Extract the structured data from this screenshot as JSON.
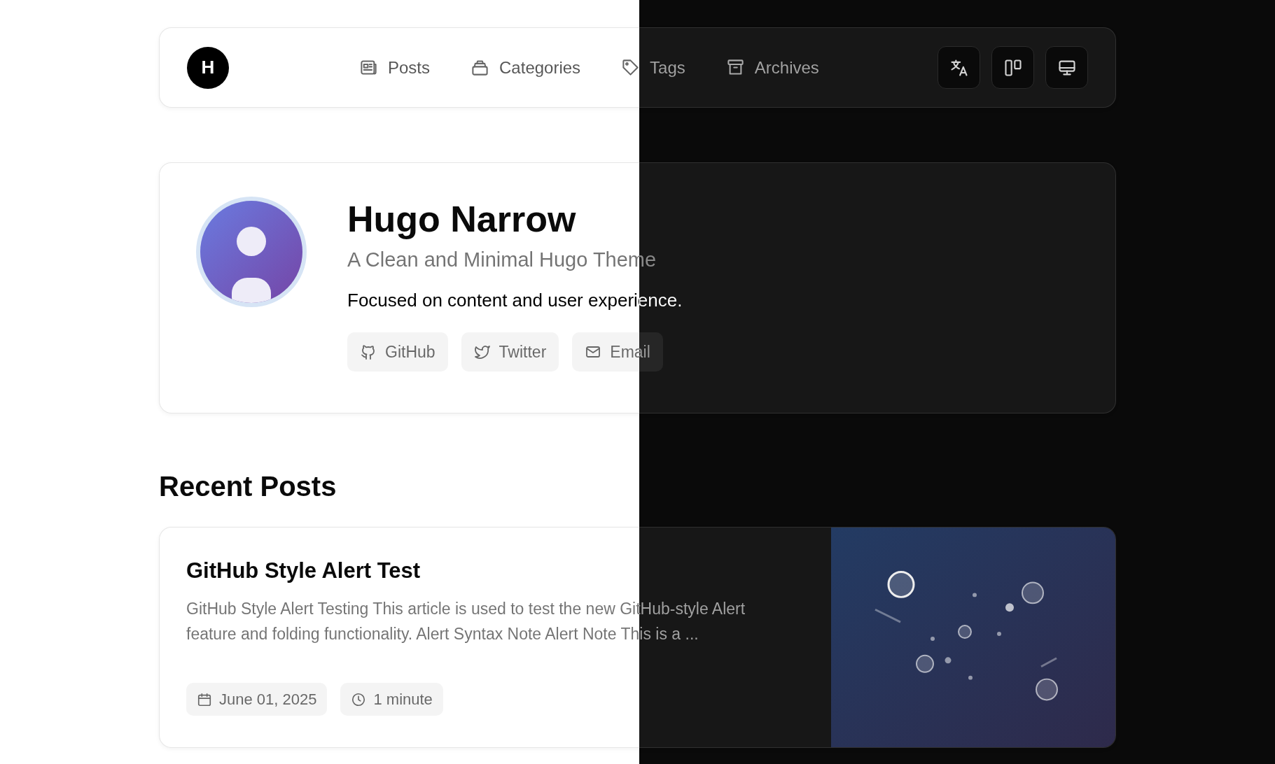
{
  "logo": "H",
  "nav": [
    {
      "label": "Posts"
    },
    {
      "label": "Categories"
    },
    {
      "label": "Tags"
    },
    {
      "label": "Archives"
    }
  ],
  "profile": {
    "name": "Hugo Narrow",
    "tagline": "A Clean and Minimal Hugo Theme",
    "description": "Focused on content and user experience.",
    "links": [
      {
        "label": "GitHub"
      },
      {
        "label": "Twitter"
      },
      {
        "label": "Email"
      }
    ]
  },
  "recent_heading": "Recent Posts",
  "posts": [
    {
      "title": "GitHub Style Alert Test",
      "excerpt": "GitHub Style Alert Testing This article is used to test the new GitHub-style Alert feature and folding functionality. Alert Syntax Note Alert Note This is a ...",
      "date": "June 01, 2025",
      "reading_time": "1 minute"
    }
  ]
}
